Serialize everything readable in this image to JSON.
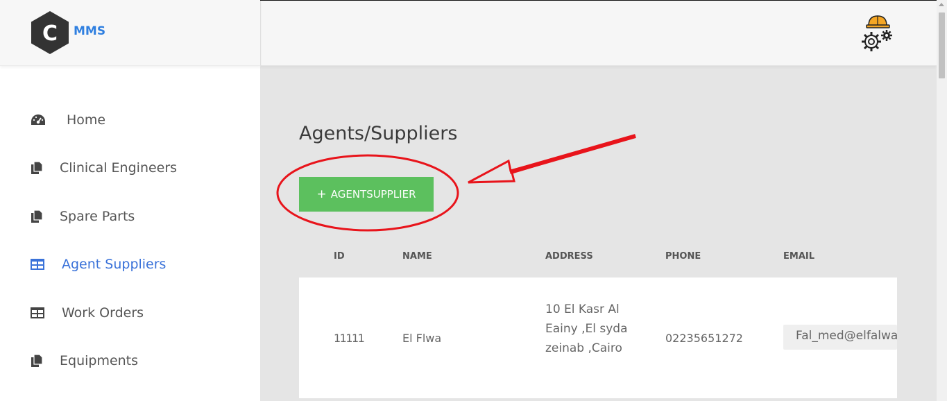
{
  "brand": {
    "logo_letter": "C",
    "name": "MMS"
  },
  "sidebar": {
    "items": [
      {
        "label": "Home",
        "icon": "dashboard-icon",
        "active": false
      },
      {
        "label": "Clinical Engineers",
        "icon": "copy-icon",
        "active": false
      },
      {
        "label": "Spare Parts",
        "icon": "copy-icon",
        "active": false
      },
      {
        "label": "Agent Suppliers",
        "icon": "table-icon",
        "active": true
      },
      {
        "label": "Work Orders",
        "icon": "table-icon",
        "active": false
      },
      {
        "label": "Equipments",
        "icon": "copy-icon",
        "active": false
      }
    ]
  },
  "topbar": {
    "avatar_icon": "engineer-gear-icon"
  },
  "main": {
    "title": "Agents/Suppliers",
    "add_button": {
      "plus": "+",
      "label": "AGENTSUPPLIER"
    },
    "table": {
      "columns": [
        "ID",
        "NAME",
        "ADDRESS",
        "PHONE",
        "EMAIL"
      ],
      "rows": [
        {
          "id": "11111",
          "name": "El Flwa",
          "address": "10 El Kasr Al Eainy ,El syda zeinab ,Cairo",
          "phone": "02235651272",
          "email": "Fal_med@elfalwa"
        }
      ]
    }
  },
  "colors": {
    "accent": "#3a72d9",
    "brand": "#2f7fe0",
    "add_button": "#5cc05e",
    "annotation": "#e8141b"
  }
}
